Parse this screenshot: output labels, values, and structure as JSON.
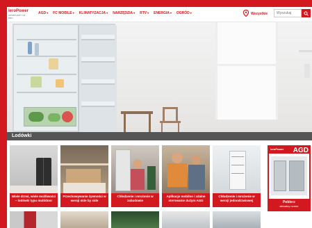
{
  "header": {
    "logo_text": "leroPower",
    "logo_sub": "OPORTUNITY OF PRO",
    "nav": [
      {
        "label": "AGD"
      },
      {
        "label": "FC MOBILE"
      },
      {
        "label": "KLIMATYZACJA"
      },
      {
        "label": "NARZĘDZIA"
      },
      {
        "label": "RTV"
      },
      {
        "label": "ENERGIA"
      },
      {
        "label": "OGRÓD"
      }
    ],
    "chevron": "▾",
    "stores_label": "Wszystkie",
    "search_placeholder": "Wyszukaj"
  },
  "section": {
    "title": "Lodówki"
  },
  "tiles": [
    {
      "caption": "Wiele drzwi, wiele możliwości – lodówki typu multidoor"
    },
    {
      "caption": "Przechowywanie żywności w wersji side by side"
    },
    {
      "caption": "Chłodzenie i mrożenie w zabudowie"
    },
    {
      "caption": "Aplikacje mobilne i zdalne sterowanie dużym AGD"
    },
    {
      "caption": "Chłodzenie i mrożenie w wersji jednodrzwiowej"
    }
  ],
  "promo": {
    "brand": "leroPower",
    "big": "AGD",
    "button_title": "Pobierz",
    "button_sub": "aktualny numer"
  },
  "colors": {
    "brand_red": "#d31920",
    "section_bar": "#464646"
  },
  "icons": {
    "store_pin": "map-pin-icon",
    "search": "search-icon",
    "chevron": "chevron-down-icon"
  }
}
